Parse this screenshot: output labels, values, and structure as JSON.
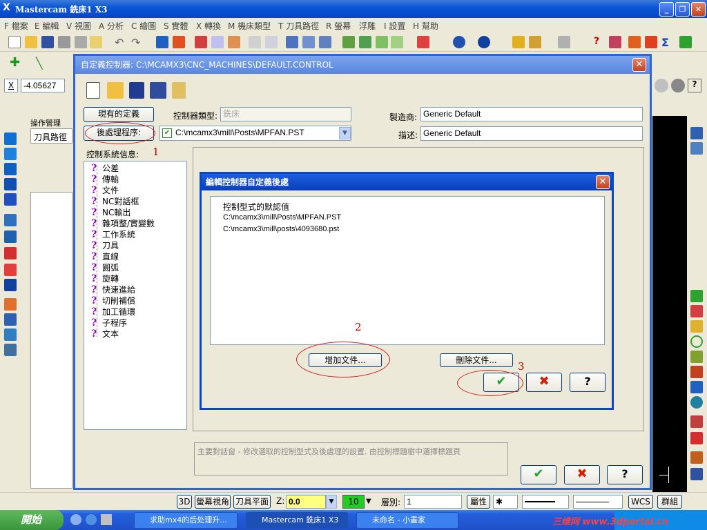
{
  "app": {
    "title": "Mastercam 銑床1 X3",
    "logo": "X"
  },
  "menu": [
    "F 檔案",
    "E 編輯",
    "V 視圖",
    "A 分析",
    "C 繪圖",
    "S 實體",
    "X 轉換",
    "M 機床類型",
    "T 刀具路徑",
    "R 螢幕",
    "浮雕",
    "I 設置",
    "H 幫助"
  ],
  "coord": {
    "axis_label": "X",
    "value": "-4.05627"
  },
  "left_panel": {
    "tab_label": "操作管理",
    "sub_label": "刀具路徑"
  },
  "dialog": {
    "title": "自定義控制器: C:\\MCAMX3\\CNC_MACHINES\\DEFAULT.CONTROL",
    "btn_existing": "現有的定義",
    "btn_post": "後處理程序:",
    "label_ctrl_type": "控制器類型:",
    "ctrl_type_value": "銑床",
    "post_path": "C:\\mcamx3\\mill\\Posts\\MPFAN.PST",
    "label_maker": "製造商:",
    "maker_value": "Generic Default",
    "label_desc": "描述:",
    "desc_value": "Generic Default",
    "tree_label": "控制系統信息:",
    "tree_items": [
      "公差",
      "傳輸",
      "文件",
      "NC對話框",
      "NC輸出",
      "雜項整/實變數",
      "工作系統",
      "刀具",
      "直線",
      "圓弧",
      "旋轉",
      "快速進給",
      "切削補償",
      "加工循環",
      "子程序",
      "文本"
    ],
    "hint": "主要對話窗 - 修改選取的控制型式及後處理的設置. 由控制標題樹中選擇標題頁"
  },
  "subdialog": {
    "title": "編輯控制器自定義後處",
    "list_header": "控制型式的默認值",
    "list_items": [
      "C:\\mcamx3\\mill\\Posts\\MPFAN.PST",
      "C:\\mcamx3\\mill\\posts\\4093680.pst"
    ],
    "btn_add": "增加文件...",
    "btn_delete": "刪除文件..."
  },
  "annotations": [
    "1",
    "2",
    "3"
  ],
  "status": {
    "btn_3d": "3D",
    "screen_view": "螢幕視角",
    "tool_plane": "刀具平面",
    "z_label": "Z:",
    "z_value": "0.0",
    "color_value": "10",
    "layer_label": "層別:",
    "layer_value": "1",
    "attr": "屬性",
    "wcs": "WCS",
    "group": "群組"
  },
  "taskbar": {
    "start": "開始",
    "items": [
      "求助mx4的后处理升...",
      "Mastercam 銑床1 X3",
      "未命名 - 小畫家"
    ],
    "watermark": "三维网 www.3dportal.cn"
  },
  "colors": {
    "xp_blue": "#0a56d6",
    "dialog_border": "#2e64d4",
    "annotation": "#c00000",
    "check": "#1fa31f",
    "cross": "#d81e05"
  }
}
